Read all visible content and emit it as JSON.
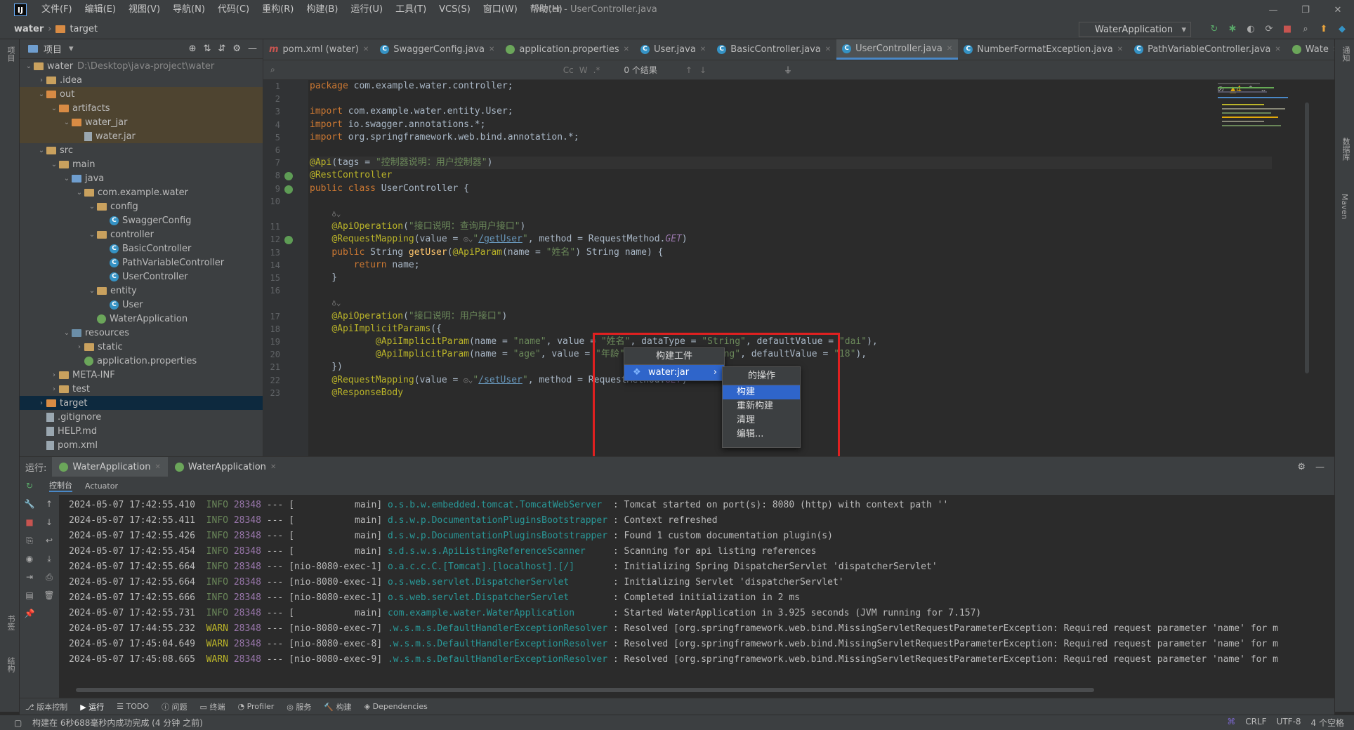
{
  "menubar": {
    "logo": "IJ",
    "items": [
      "文件(F)",
      "编辑(E)",
      "视图(V)",
      "导航(N)",
      "代码(C)",
      "重构(R)",
      "构建(B)",
      "运行(U)",
      "工具(T)",
      "VCS(S)",
      "窗口(W)",
      "帮助(H)"
    ],
    "title": "water - UserController.java"
  },
  "navbar": {
    "project": "water",
    "crumb": "target",
    "run_config": "WaterApplication"
  },
  "project_panel": {
    "title": "项目",
    "tree": [
      {
        "label": "water",
        "path": "D:\\Desktop\\java-project\\water",
        "indent": 0,
        "arrow": "⌄",
        "icon": "folder"
      },
      {
        "label": ".idea",
        "indent": 1,
        "arrow": "›",
        "icon": "folder"
      },
      {
        "label": "out",
        "indent": 1,
        "arrow": "⌄",
        "icon": "folder-orange",
        "hl": true
      },
      {
        "label": "artifacts",
        "indent": 2,
        "arrow": "⌄",
        "icon": "folder-orange",
        "hl": true
      },
      {
        "label": "water_jar",
        "indent": 3,
        "arrow": "⌄",
        "icon": "folder-orange",
        "hl": true
      },
      {
        "label": "water.jar",
        "indent": 4,
        "arrow": "",
        "icon": "file",
        "hl": true
      },
      {
        "label": "src",
        "indent": 1,
        "arrow": "⌄",
        "icon": "folder"
      },
      {
        "label": "main",
        "indent": 2,
        "arrow": "⌄",
        "icon": "folder"
      },
      {
        "label": "java",
        "indent": 3,
        "arrow": "⌄",
        "icon": "folder-blue"
      },
      {
        "label": "com.example.water",
        "indent": 4,
        "arrow": "⌄",
        "icon": "folder"
      },
      {
        "label": "config",
        "indent": 5,
        "arrow": "⌄",
        "icon": "folder"
      },
      {
        "label": "SwaggerConfig",
        "indent": 6,
        "arrow": "",
        "icon": "class"
      },
      {
        "label": "controller",
        "indent": 5,
        "arrow": "⌄",
        "icon": "folder"
      },
      {
        "label": "BasicController",
        "indent": 6,
        "arrow": "",
        "icon": "class"
      },
      {
        "label": "PathVariableController",
        "indent": 6,
        "arrow": "",
        "icon": "class"
      },
      {
        "label": "UserController",
        "indent": 6,
        "arrow": "",
        "icon": "class"
      },
      {
        "label": "entity",
        "indent": 5,
        "arrow": "⌄",
        "icon": "folder"
      },
      {
        "label": "User",
        "indent": 6,
        "arrow": "",
        "icon": "class"
      },
      {
        "label": "WaterApplication",
        "indent": 5,
        "arrow": "",
        "icon": "spring"
      },
      {
        "label": "resources",
        "indent": 3,
        "arrow": "⌄",
        "icon": "folder-teal"
      },
      {
        "label": "static",
        "indent": 4,
        "arrow": "›",
        "icon": "folder"
      },
      {
        "label": "application.properties",
        "indent": 4,
        "arrow": "",
        "icon": "spring"
      },
      {
        "label": "META-INF",
        "indent": 2,
        "arrow": "›",
        "icon": "folder"
      },
      {
        "label": "test",
        "indent": 2,
        "arrow": "›",
        "icon": "folder"
      },
      {
        "label": "target",
        "indent": 1,
        "arrow": "›",
        "icon": "folder-orange",
        "sel": true
      },
      {
        "label": ".gitignore",
        "indent": 1,
        "arrow": "",
        "icon": "file"
      },
      {
        "label": "HELP.md",
        "indent": 1,
        "arrow": "",
        "icon": "file"
      },
      {
        "label": "pom.xml",
        "indent": 1,
        "arrow": "",
        "icon": "file"
      }
    ]
  },
  "editor": {
    "tabs": [
      {
        "label": "pom.xml (water)",
        "icon": "m"
      },
      {
        "label": "SwaggerConfig.java",
        "icon": "C"
      },
      {
        "label": "application.properties",
        "icon": "s"
      },
      {
        "label": "User.java",
        "icon": "C"
      },
      {
        "label": "BasicController.java",
        "icon": "C"
      },
      {
        "label": "UserController.java",
        "icon": "C",
        "active": true
      },
      {
        "label": "NumberFormatException.java",
        "icon": "C"
      },
      {
        "label": "PathVariableController.java",
        "icon": "C"
      },
      {
        "label": "Wate",
        "icon": "s"
      }
    ],
    "find_results": "0 个结果",
    "warnings": "▲4",
    "lines": [
      {
        "n": "1",
        "html": "<span class=\"kw\">package</span> com.example.water.controller;"
      },
      {
        "n": "2",
        "html": ""
      },
      {
        "n": "3",
        "html": "<span class=\"kw\">import</span> com.example.water.entity.User;"
      },
      {
        "n": "4",
        "html": "<span class=\"kw\">import</span> io.swagger.annotations.*;"
      },
      {
        "n": "5",
        "html": "<span class=\"kw\">import</span> org.springframework.web.bind.annotation.*;"
      },
      {
        "n": "6",
        "html": ""
      },
      {
        "n": "7",
        "html": "<span class=\"an\">@Api</span>(tags = <span class=\"str\">\"控制器说明：用户控制器\"</span>)",
        "cur": true
      },
      {
        "n": "8",
        "html": "<span class=\"an\">@RestController</span>"
      },
      {
        "n": "9",
        "html": "<span class=\"kw\">public class</span> UserController {"
      },
      {
        "n": "10",
        "html": ""
      },
      {
        "n": "",
        "html": "    <span class=\"hint\">♁⌄</span>"
      },
      {
        "n": "11",
        "html": "    <span class=\"an\">@ApiOperation</span>(<span class=\"str\">\"接口说明：查询用户接口\"</span>)"
      },
      {
        "n": "12",
        "html": "    <span class=\"an\">@RequestMapping</span>(value = <span class=\"hint\">◎⌄</span><span class=\"str\">\"<span class=\"lnk\">/getUser</span>\"</span>, method = RequestMethod.<span class=\"en\">GET</span>)"
      },
      {
        "n": "13",
        "html": "    <span class=\"kw\">public</span> String <span class=\"fn\">getUser</span>(<span class=\"an\">@ApiParam</span>(name = <span class=\"str\">\"姓名\"</span>) String name) {"
      },
      {
        "n": "14",
        "html": "        <span class=\"kw\">return</span> name;"
      },
      {
        "n": "15",
        "html": "    }"
      },
      {
        "n": "16",
        "html": ""
      },
      {
        "n": "",
        "html": "    <span class=\"hint\">♁⌄</span>"
      },
      {
        "n": "17",
        "html": "    <span class=\"an\">@ApiOperation</span>(<span class=\"str\">\"接口说明：用户接口\"</span>)"
      },
      {
        "n": "18",
        "html": "    <span class=\"an\">@ApiImplicitParams</span>({"
      },
      {
        "n": "19",
        "html": "            <span class=\"an\">@ApiImplicitParam</span>(name = <span class=\"str\">\"name\"</span>, value = <span class=\"str\">\"姓名\"</span>, dataType = <span class=\"str\">\"String\"</span>, defaultValue = <span class=\"str\">\"dai\"</span>),"
      },
      {
        "n": "20",
        "html": "            <span class=\"an\">@ApiImplicitParam</span>(name = <span class=\"str\">\"age\"</span>, value = <span class=\"str\">\"年龄\"</span>, dataType = <span class=\"str\">\"String\"</span>, defaultValue = <span class=\"str\">\"18\"</span>),"
      },
      {
        "n": "21",
        "html": "    })"
      },
      {
        "n": "22",
        "html": "    <span class=\"an\">@RequestMapping</span>(value = <span class=\"hint\">◎⌄</span><span class=\"str\">\"<span class=\"lnk\">/setUser</span>\"</span>, method = RequestMethod.<span class=\"en\">GET</span>)"
      },
      {
        "n": "23",
        "html": "    <span class=\"an\">@ResponseBody</span>"
      }
    ]
  },
  "popup_build": {
    "title": "构建工件",
    "item": "water:jar"
  },
  "popup_actions": {
    "title": "的操作",
    "items": [
      "构建",
      "重新构建",
      "清理",
      "编辑..."
    ]
  },
  "run_panel": {
    "label": "运行:",
    "tabs": [
      "WaterApplication",
      "WaterApplication"
    ],
    "subtabs": [
      "控制台",
      "Actuator"
    ],
    "logs": [
      [
        "2024-05-07 17:42:55.410",
        "INFO",
        "28348",
        "---",
        "[           main]",
        "o.s.b.w.embedded.tomcat.TomcatWebServer ",
        ": Tomcat started on port(s): 8080 (http) with context path ''"
      ],
      [
        "2024-05-07 17:42:55.411",
        "INFO",
        "28348",
        "---",
        "[           main]",
        "d.s.w.p.DocumentationPluginsBootstrapper",
        ": Context refreshed"
      ],
      [
        "2024-05-07 17:42:55.426",
        "INFO",
        "28348",
        "---",
        "[           main]",
        "d.s.w.p.DocumentationPluginsBootstrapper",
        ": Found 1 custom documentation plugin(s)"
      ],
      [
        "2024-05-07 17:42:55.454",
        "INFO",
        "28348",
        "---",
        "[           main]",
        "s.d.s.w.s.ApiListingReferenceScanner    ",
        ": Scanning for api listing references"
      ],
      [
        "2024-05-07 17:42:55.664",
        "INFO",
        "28348",
        "---",
        "[nio-8080-exec-1]",
        "o.a.c.c.C.[Tomcat].[localhost].[/]      ",
        ": Initializing Spring DispatcherServlet 'dispatcherServlet'"
      ],
      [
        "2024-05-07 17:42:55.664",
        "INFO",
        "28348",
        "---",
        "[nio-8080-exec-1]",
        "o.s.web.servlet.DispatcherServlet       ",
        ": Initializing Servlet 'dispatcherServlet'"
      ],
      [
        "2024-05-07 17:42:55.666",
        "INFO",
        "28348",
        "---",
        "[nio-8080-exec-1]",
        "o.s.web.servlet.DispatcherServlet       ",
        ": Completed initialization in 2 ms"
      ],
      [
        "2024-05-07 17:42:55.731",
        "INFO",
        "28348",
        "---",
        "[           main]",
        "com.example.water.WaterApplication      ",
        ": Started WaterApplication in 3.925 seconds (JVM running for 7.157)"
      ],
      [
        "2024-05-07 17:44:55.232",
        "WARN",
        "28348",
        "---",
        "[nio-8080-exec-7]",
        ".w.s.m.s.DefaultHandlerExceptionResolver",
        ": Resolved [org.springframework.web.bind.MissingServletRequestParameterException: Required request parameter 'name' for m"
      ],
      [
        "2024-05-07 17:45:04.649",
        "WARN",
        "28348",
        "---",
        "[nio-8080-exec-8]",
        ".w.s.m.s.DefaultHandlerExceptionResolver",
        ": Resolved [org.springframework.web.bind.MissingServletRequestParameterException: Required request parameter 'name' for m"
      ],
      [
        "2024-05-07 17:45:08.665",
        "WARN",
        "28348",
        "---",
        "[nio-8080-exec-9]",
        ".w.s.m.s.DefaultHandlerExceptionResolver",
        ": Resolved [org.springframework.web.bind.MissingServletRequestParameterException: Required request parameter 'name' for m"
      ]
    ]
  },
  "bottom_tabs": [
    "版本控制",
    "运行",
    "TODO",
    "问题",
    "终端",
    "Profiler",
    "服务",
    "构建",
    "Dependencies"
  ],
  "status": {
    "message": "构建在 6秒688毫秒内成功完成 (4 分钟 之前)",
    "line_sep": "CRLF",
    "encoding": "UTF-8",
    "indent": "4 个空格"
  },
  "left_tool_labels": [
    "项目",
    "书签",
    "结构"
  ],
  "right_tool_labels": [
    "通知",
    "数据库",
    "Maven"
  ]
}
